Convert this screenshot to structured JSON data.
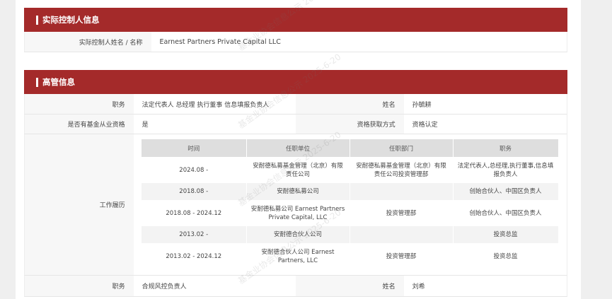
{
  "controller": {
    "title": "实际控制人信息",
    "label": "实际控制人姓名 / 名称",
    "value": "Earnest Partners Private Capital LLC"
  },
  "executives": {
    "title": "高管信息",
    "person1": {
      "position_label": "职务",
      "position_value": "法定代表人 总经理 执行董事 信息填报负责人",
      "name_label": "姓名",
      "name_value": "孙毓耕",
      "qual_label": "是否有基金从业资格",
      "qual_value": "是",
      "method_label": "资格获取方式",
      "method_value": "资格认定",
      "history_label": "工作履历",
      "history_headers": [
        "时间",
        "任职单位",
        "任职部门",
        "职务"
      ],
      "history_rows": [
        {
          "time": "2024.08 -",
          "unit": "安耐德私募基金管理（北京）有限责任公司",
          "dept": "安耐德私募基金管理（北京）有限责任公司投资管理部",
          "role": "法定代表人,总经理,执行董事,信息填报负责人"
        },
        {
          "time": "2018.08 -",
          "unit": "安耐德私募公司",
          "dept": "",
          "role": "创始合伙人、中国区负责人"
        },
        {
          "time": "2018.08 - 2024.12",
          "unit": "安耐德私募公司 Earnest Partners Private Capital, LLC",
          "dept": "投资管理部",
          "role": "创始合伙人、中国区负责人"
        },
        {
          "time": "2013.02 -",
          "unit": "安耐德合伙人公司",
          "dept": "",
          "role": "投资总监"
        },
        {
          "time": "2013.02 - 2024.12",
          "unit": "安耐德合伙人公司 Earnest Partners, LLC",
          "dept": "投资管理部",
          "role": "投资总监"
        }
      ]
    },
    "person2": {
      "position_label": "职务",
      "position_value": "合规风控负责人",
      "name_label": "姓名",
      "name_value": "刘希"
    }
  },
  "watermark_text": "基金业协会信息公示 2025-6-20"
}
